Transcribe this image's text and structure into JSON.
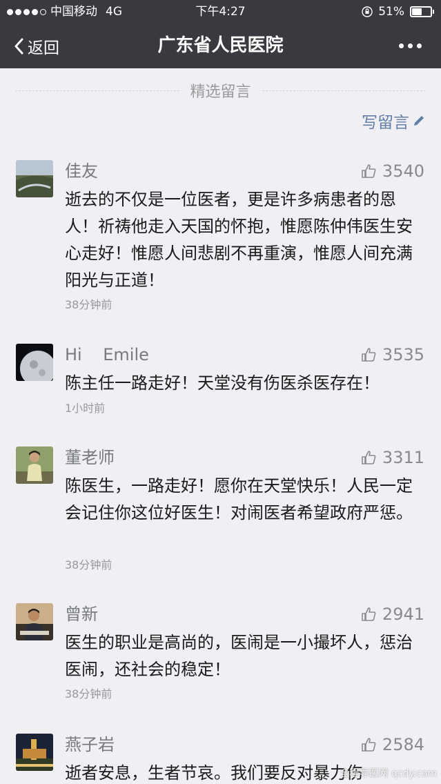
{
  "status_bar": {
    "carrier": "中国移动",
    "network": "4G",
    "time": "下午4:27",
    "battery": "51%",
    "battery_level": 0.51
  },
  "nav": {
    "back_label": "返回",
    "title": "广东省人民医院"
  },
  "section": {
    "title": "精选留言",
    "write_label": "写留言"
  },
  "comments": [
    {
      "author": "佳友",
      "likes": "3540",
      "text": "逝去的不仅是一位医者，更是许多病患者的恩人！祈祷他走入天国的怀抱，惟愿陈仲伟医生安心走好！惟愿人间悲剧不再重演，惟愿人间充满阳光与正道！",
      "time": "38分钟前"
    },
    {
      "author": "Hi    Emile",
      "likes": "3535",
      "text": "陈主任一路走好！天堂没有伤医杀医存在！",
      "time": "1小时前"
    },
    {
      "author": "董老师",
      "likes": "3311",
      "text": "陈医生，一路走好！愿你在天堂快乐！人民一定会记住你这位好医生！对闹医者希望政府严惩。",
      "time": "38分钟前"
    },
    {
      "author": "曾新",
      "likes": "2941",
      "text": "医生的职业是高尚的，医闹是一小撮坏人，惩治医闹，还社会的稳定！",
      "time": "38分钟前"
    },
    {
      "author": "燕子岩",
      "likes": "2584",
      "text": "逝者安息，生者节哀。我们要反对暴力伤",
      "time": ""
    }
  ],
  "watermark": "全程导医网 qcdy.com",
  "icons": {
    "back": "chevron-left-icon",
    "more": "more-dots-icon",
    "pencil": "pencil-icon",
    "like": "thumbs-up-icon",
    "lock": "rotation-lock-icon"
  },
  "colors": {
    "nav_bg": "#393a3f",
    "page_bg": "#efeff4",
    "link": "#607fa6"
  }
}
